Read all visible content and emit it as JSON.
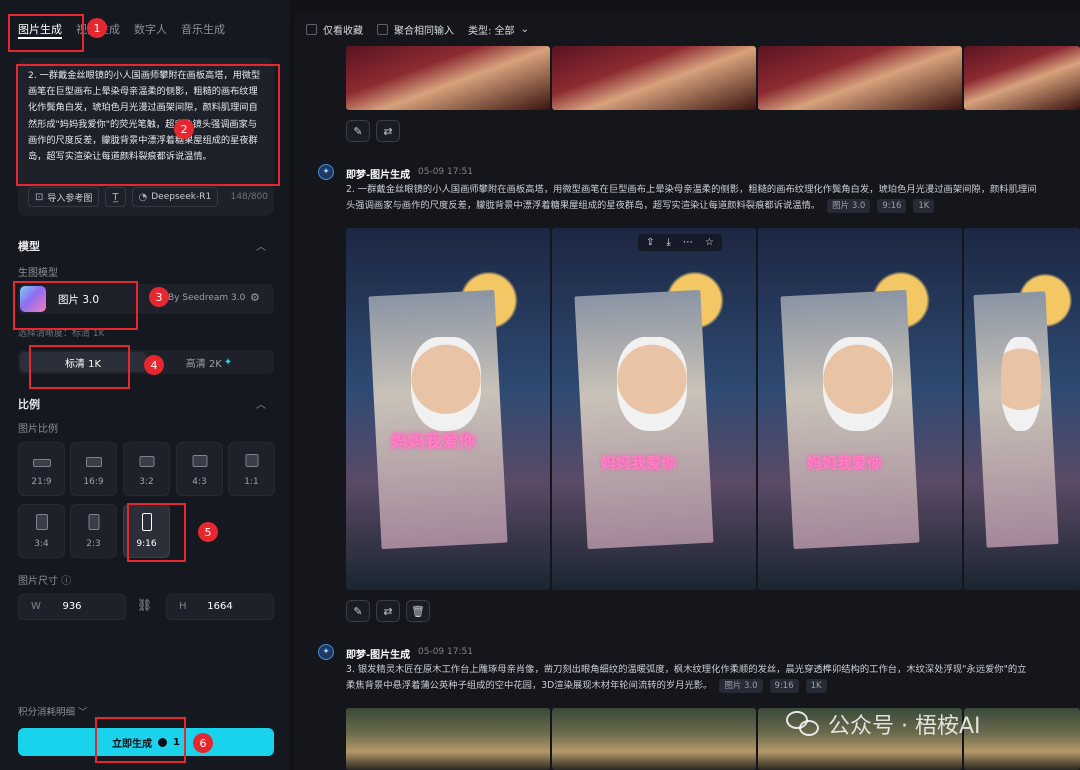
{
  "left": {
    "tabs": [
      {
        "label": "图片生成",
        "active": true
      },
      {
        "label": "视频生成",
        "active": false
      },
      {
        "label": "数字人",
        "active": false
      },
      {
        "label": "音乐生成",
        "active": false
      }
    ],
    "prompt": {
      "text": "2. 一群戴金丝眼镜的小人国画师攀附在画板高塔，用微型画笔在巨型画布上晕染母亲温柔的侧影，粗糙的画布纹理化作鬓角白发，琥珀色月光漫过画架间隙，颜料肌理间自然形成\"妈妈我爱你\"的荧光笔触，超广角镜头强调画家与画作的尺度反差，朦胧背景中漂浮着糖果屋组成的星夜群岛，超写实渲染让每道颜料裂痕都诉说温情。",
      "ref_button": "导入参考图",
      "model_button": "Deepseek-R1",
      "counter": "148/800"
    },
    "model": {
      "section_title": "模型",
      "sub_label": "生图模型",
      "name": "图片 3.0",
      "by": "By Seedream 3.0"
    },
    "resolution": {
      "hint": "选择清晰度：标清 1K",
      "options": [
        {
          "label": "标清 1K",
          "selected": true
        },
        {
          "label": "高清 2K",
          "selected": false
        }
      ],
      "star": "✦"
    },
    "ratio": {
      "section_title": "比例",
      "sub_label": "图片比例",
      "options": [
        {
          "label": "21:9",
          "selected": false
        },
        {
          "label": "16:9",
          "selected": false
        },
        {
          "label": "3:2",
          "selected": false
        },
        {
          "label": "4:3",
          "selected": false
        },
        {
          "label": "1:1",
          "selected": false
        },
        {
          "label": "3:4",
          "selected": false
        },
        {
          "label": "2:3",
          "selected": false
        },
        {
          "label": "9:16",
          "selected": true
        }
      ]
    },
    "size": {
      "label": "图片尺寸",
      "w_key": "W",
      "w_value": "936",
      "h_key": "H",
      "h_value": "1664"
    },
    "cost_label": "积分消耗明细",
    "generate": {
      "label": "立即生成",
      "cost": "1"
    }
  },
  "callouts": [
    "1",
    "2",
    "3",
    "4",
    "5",
    "6"
  ],
  "right": {
    "filters": {
      "only_fav": "仅看收藏",
      "merge": "聚合相同输入",
      "type_label": "类型: 全部"
    },
    "posts": [
      {
        "author": "即梦-图片生成",
        "time": "05-09   17:51",
        "desc1": "2. 一群戴金丝眼镜的小人国画师攀附在画板高塔，用微型画笔在巨型画布上晕染母亲温柔的侧影，粗糙的画布纹理化作鬓角白发，琥珀色月光漫过画架间隙，颜料肌理间",
        "desc2": "头强调画家与画作的尺度反差，朦胧背景中漂浮着糖果屋组成的星夜群岛，超写实渲染让每道颜料裂痕都诉说温情。",
        "tags": [
          "图片 3.0",
          "9:16",
          "1K"
        ],
        "image_text": "妈妈我爱你"
      },
      {
        "author": "即梦-图片生成",
        "time": "05-09   17:51",
        "desc1": "3. 银发精灵木匠在原木工作台上雕琢母亲肖像，凿刀刻出眼角细纹的温暖弧度，枫木纹理化作柔顺的发丝，晨光穿透榫卯结构的工作台，木纹深处浮现\"永远爱你\"的立",
        "desc2": "柔焦背景中悬浮着蒲公英种子组成的空中花园，3D渲染展现木材年轮间流转的岁月光影。",
        "tags": [
          "图片 3.0",
          "9:16",
          "1K"
        ]
      }
    ],
    "watermark": "公众号 · 梧桉AI"
  }
}
